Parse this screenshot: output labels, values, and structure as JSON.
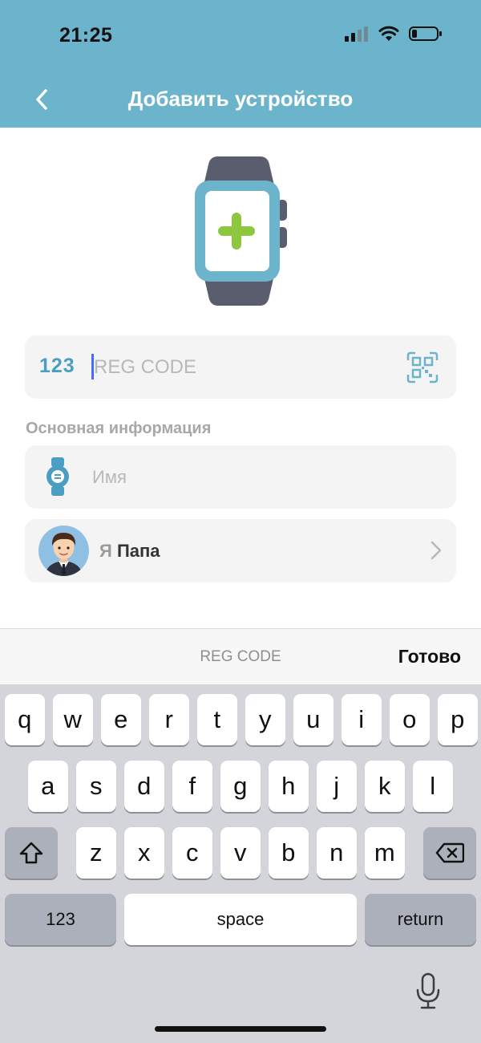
{
  "status_bar": {
    "time": "21:25"
  },
  "header": {
    "title": "Добавить устройство"
  },
  "reg_field": {
    "prefix": "123",
    "placeholder": "REG CODE"
  },
  "section": {
    "label": "Основная информация"
  },
  "name_field": {
    "placeholder": "Имя"
  },
  "role_field": {
    "prefix": "Я",
    "value": "Папа"
  },
  "accessory_bar": {
    "field_name": "REG CODE",
    "done_label": "Готово"
  },
  "keyboard": {
    "row1": [
      "q",
      "w",
      "e",
      "r",
      "t",
      "y",
      "u",
      "i",
      "o",
      "p"
    ],
    "row2": [
      "a",
      "s",
      "d",
      "f",
      "g",
      "h",
      "j",
      "k",
      "l"
    ],
    "row3": [
      "z",
      "x",
      "c",
      "v",
      "b",
      "n",
      "m"
    ],
    "numbers_label": "123",
    "space_label": "space",
    "return_label": "return"
  },
  "colors": {
    "header": "#6cb3cc",
    "accent": "#4a9ec4",
    "plus": "#8dc63f"
  }
}
